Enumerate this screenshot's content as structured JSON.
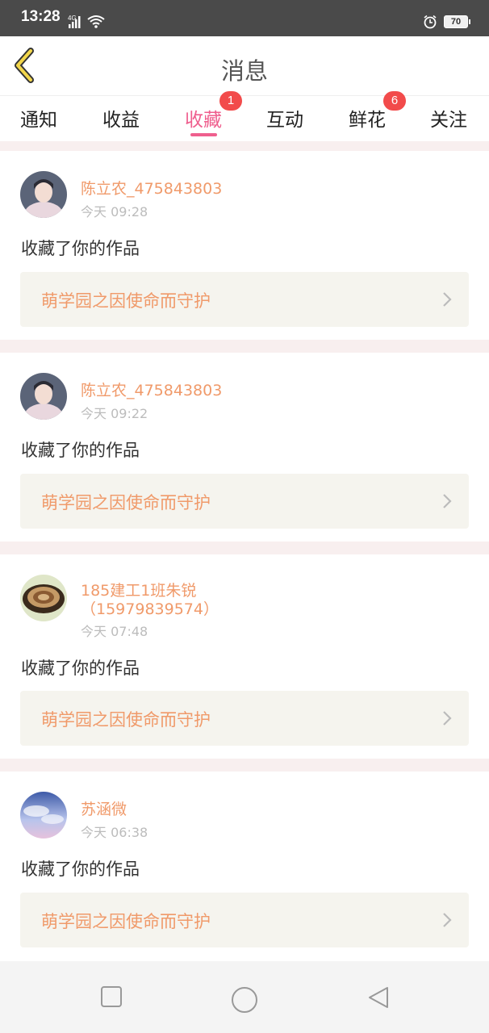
{
  "status": {
    "time": "13:28",
    "network": "4G",
    "battery": "70"
  },
  "header": {
    "title": "消息"
  },
  "tabs": [
    {
      "label": "通知"
    },
    {
      "label": "收益"
    },
    {
      "label": "收藏",
      "badge": "1",
      "active": true
    },
    {
      "label": "互动"
    },
    {
      "label": "鲜花",
      "badge": "6"
    },
    {
      "label": "关注"
    }
  ],
  "items": [
    {
      "user": "陈立农_475843803",
      "time": "今天 09:28",
      "action": "收藏了你的作品",
      "work": "萌学园之因使命而守护"
    },
    {
      "user": "陈立农_475843803",
      "time": "今天 09:22",
      "action": "收藏了你的作品",
      "work": "萌学园之因使命而守护"
    },
    {
      "user_line1": "185建工1班朱锐",
      "user_line2": "（15979839574）",
      "time": "今天 07:48",
      "action": "收藏了你的作品",
      "work": "萌学园之因使命而守护"
    },
    {
      "user": "苏涵微",
      "time": "今天 06:38",
      "action": "收藏了你的作品",
      "work": "萌学园之因使命而守护"
    }
  ],
  "colors": {
    "accent_pink": "#ef5f8e",
    "name_orange": "#f09a6a",
    "badge_red": "#f24b4b",
    "back_yellow": "#f2d64b"
  },
  "icons": [
    "back-icon",
    "chevron-right-icon",
    "recent-apps-icon",
    "home-icon",
    "back-nav-icon",
    "alarm-icon",
    "wifi-icon",
    "signal-icon"
  ]
}
